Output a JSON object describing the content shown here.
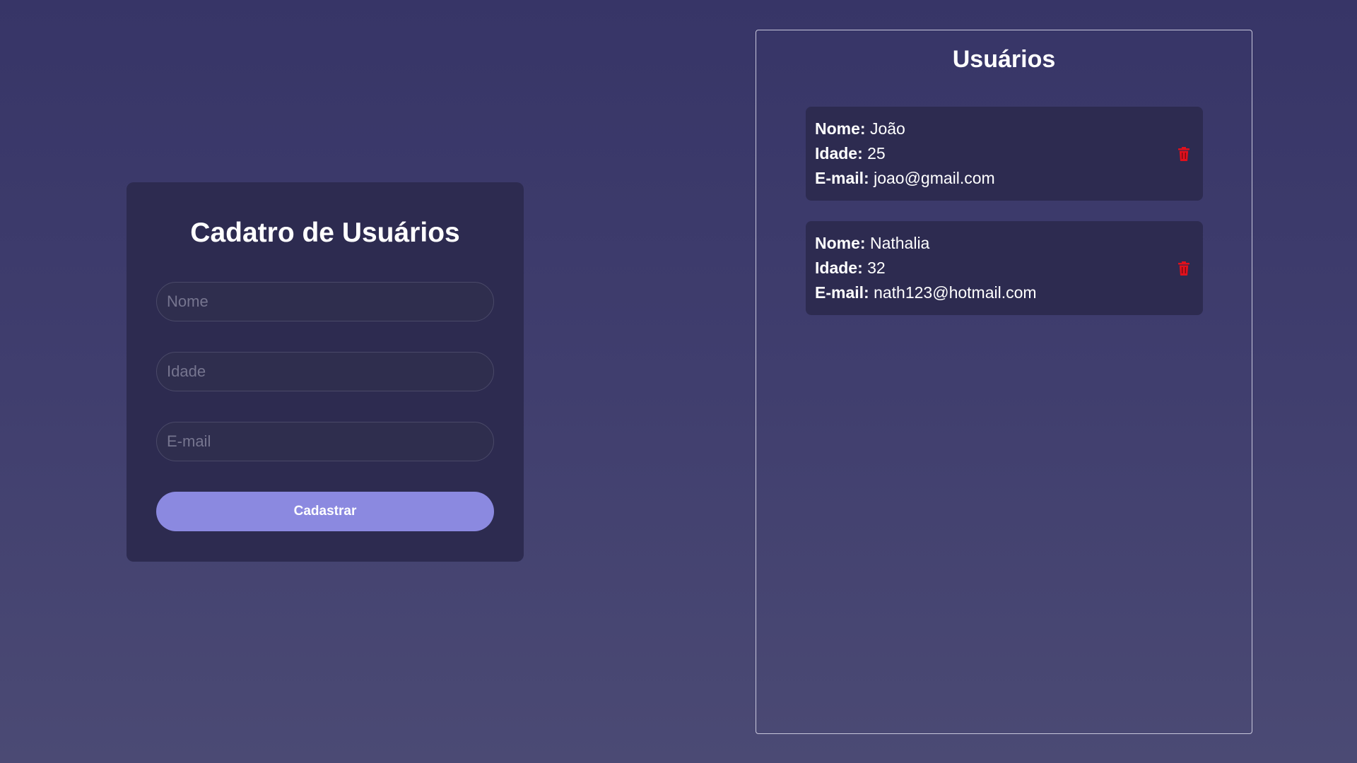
{
  "form": {
    "title": "Cadatro de Usuários",
    "name_placeholder": "Nome",
    "age_placeholder": "Idade",
    "email_placeholder": "E-mail",
    "submit_label": "Cadastrar"
  },
  "users_panel": {
    "title": "Usuários",
    "labels": {
      "name": "Nome:",
      "age": "Idade:",
      "email": "E-mail:"
    },
    "users": [
      {
        "name": "João",
        "age": "25",
        "email": "joao@gmail.com"
      },
      {
        "name": "Nathalia",
        "age": "32",
        "email": "nath123@hotmail.com"
      }
    ],
    "delete_icon": "trash-icon"
  },
  "colors": {
    "accent": "#8b89e0",
    "card_bg": "#2d2b50",
    "delete": "#e0101c"
  }
}
